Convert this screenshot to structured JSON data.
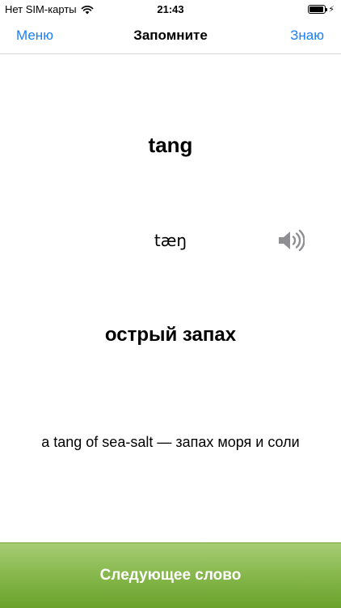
{
  "status_bar": {
    "carrier": "Нет SIM-карты",
    "time": "21:43",
    "battery_level": 0.95
  },
  "nav": {
    "menu": "Меню",
    "title": "Запомните",
    "know": "Знаю"
  },
  "card": {
    "word": "tang",
    "transcription": "tæŋ",
    "translation": "острый запах",
    "example": "a tang of sea-salt — запах моря и соли"
  },
  "next_button": {
    "label": "Следующее слово"
  },
  "icons": {
    "wifi": "wifi-icon",
    "battery": "battery-icon",
    "charging": "charging-bolt-icon",
    "speaker": "speaker-icon"
  },
  "colors": {
    "accent": "#1b7ff5",
    "button_top": "#a7cd74",
    "button_bottom": "#6aa22b"
  }
}
